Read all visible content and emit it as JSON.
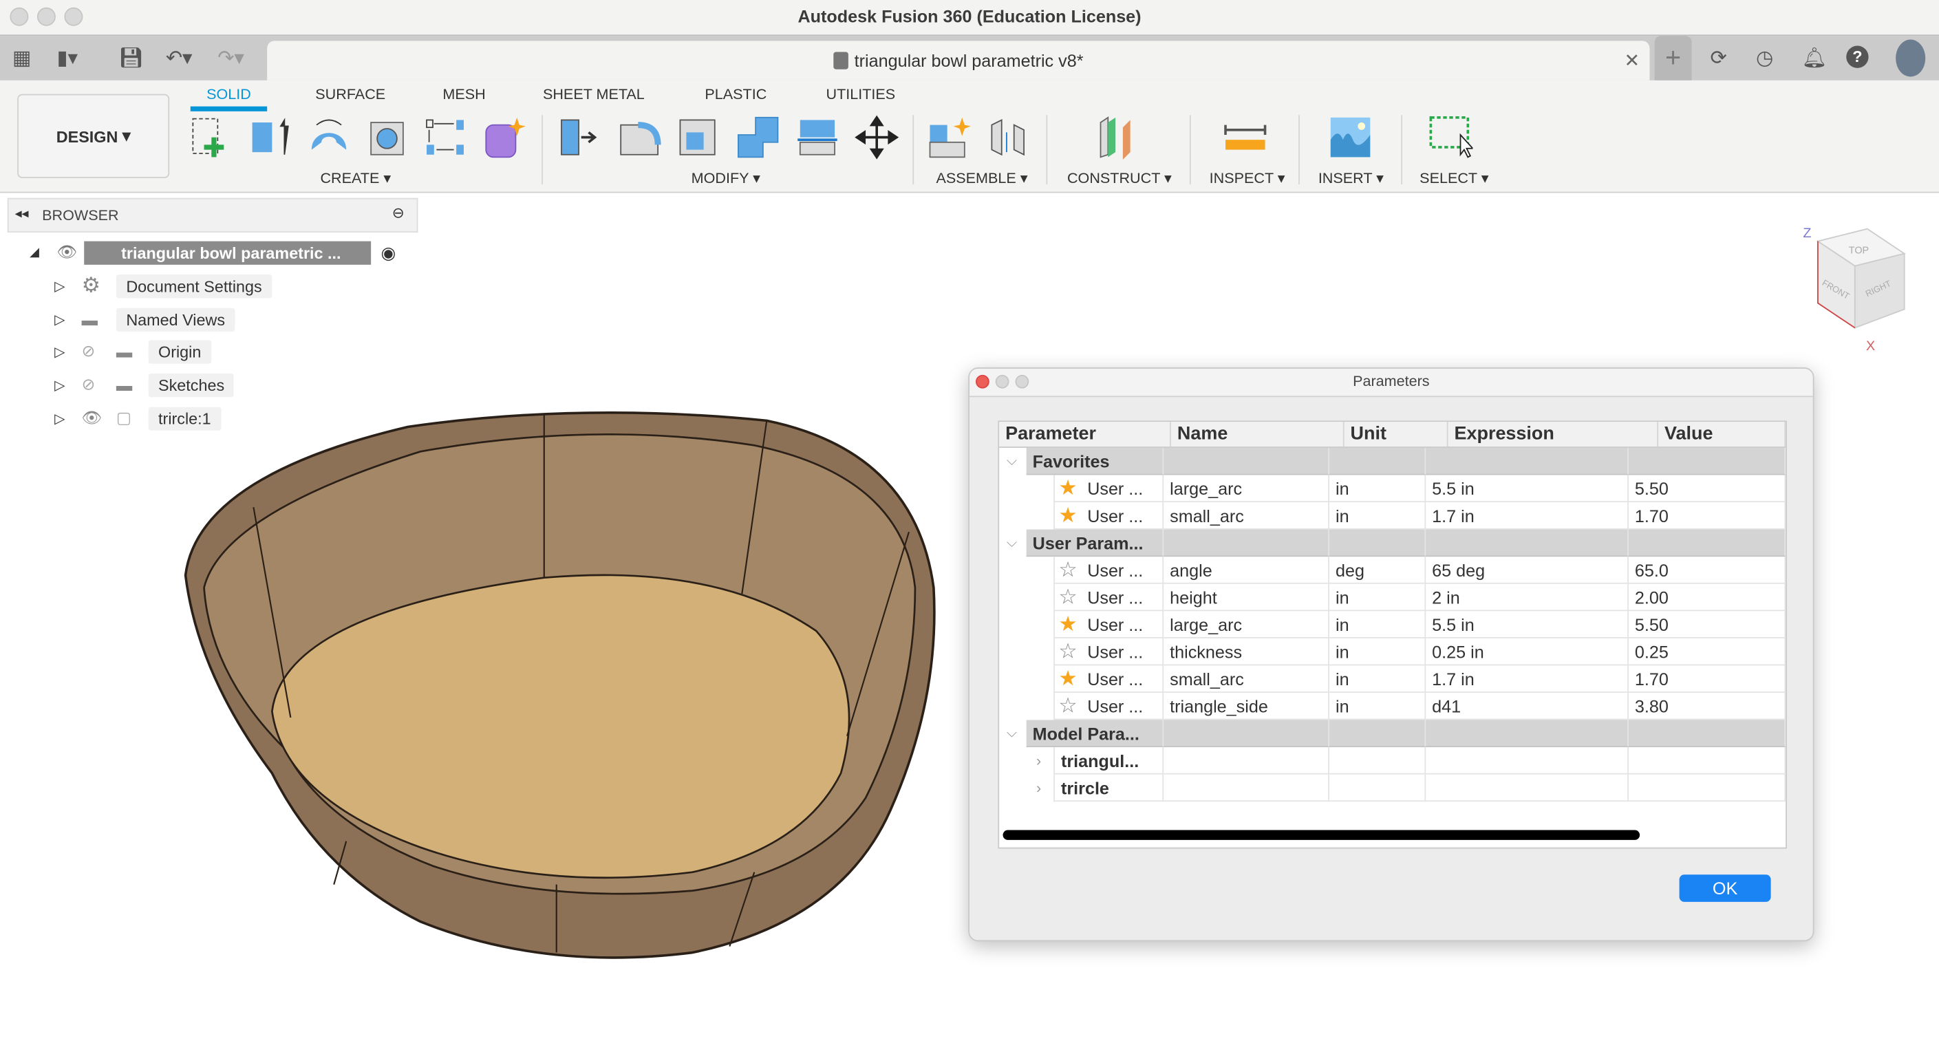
{
  "app_title": "Autodesk Fusion 360 (Education License)",
  "document_tab": {
    "title": "triangular bowl parametric v8*"
  },
  "workspace": "DESIGN",
  "ribbon_tabs": [
    {
      "label": "SOLID",
      "active": true
    },
    {
      "label": "SURFACE"
    },
    {
      "label": "MESH"
    },
    {
      "label": "SHEET METAL"
    },
    {
      "label": "PLASTIC"
    },
    {
      "label": "UTILITIES"
    }
  ],
  "ribbon_groups": [
    "CREATE",
    "MODIFY",
    "ASSEMBLE",
    "CONSTRUCT",
    "INSPECT",
    "INSERT",
    "SELECT"
  ],
  "browser": {
    "title": "BROWSER",
    "root": "triangular bowl parametric ...",
    "items": [
      "Document Settings",
      "Named Views",
      "Origin",
      "Sketches",
      "trircle:1"
    ]
  },
  "viewcube": {
    "top": "TOP",
    "front": "FRONT",
    "right": "RIGHT",
    "z": "Z",
    "x": "X"
  },
  "parameters": {
    "title": "Parameters",
    "columns": [
      "Parameter",
      "Name",
      "Unit",
      "Expression",
      "Value"
    ],
    "groups": [
      {
        "label": "Favorites",
        "rows": [
          {
            "param": "User ...",
            "name": "large_arc",
            "unit": "in",
            "expr": "5.5 in",
            "value": "5.50",
            "fav": true
          },
          {
            "param": "User ...",
            "name": "small_arc",
            "unit": "in",
            "expr": "1.7 in",
            "value": "1.70",
            "fav": true
          }
        ]
      },
      {
        "label": "User Param...",
        "rows": [
          {
            "param": "User ...",
            "name": "angle",
            "unit": "deg",
            "expr": "65 deg",
            "value": "65.0",
            "fav": false
          },
          {
            "param": "User ...",
            "name": "height",
            "unit": "in",
            "expr": "2 in",
            "value": "2.00",
            "fav": false
          },
          {
            "param": "User ...",
            "name": "large_arc",
            "unit": "in",
            "expr": "5.5 in",
            "value": "5.50",
            "fav": true
          },
          {
            "param": "User ...",
            "name": "thickness",
            "unit": "in",
            "expr": "0.25 in",
            "value": "0.25",
            "fav": false
          },
          {
            "param": "User ...",
            "name": "small_arc",
            "unit": "in",
            "expr": "1.7 in",
            "value": "1.70",
            "fav": true
          },
          {
            "param": "User ...",
            "name": "triangle_side",
            "unit": "in",
            "expr": "d41",
            "value": "3.80",
            "fav": false
          }
        ]
      },
      {
        "label": "Model Para...",
        "rows": [
          {
            "param": "triangul..."
          },
          {
            "param": "trircle"
          }
        ]
      }
    ],
    "ok_label": "OK"
  },
  "colors": {
    "accent": "#0696d7",
    "ok_button": "#1a84f4",
    "star": "#f7a51c"
  }
}
